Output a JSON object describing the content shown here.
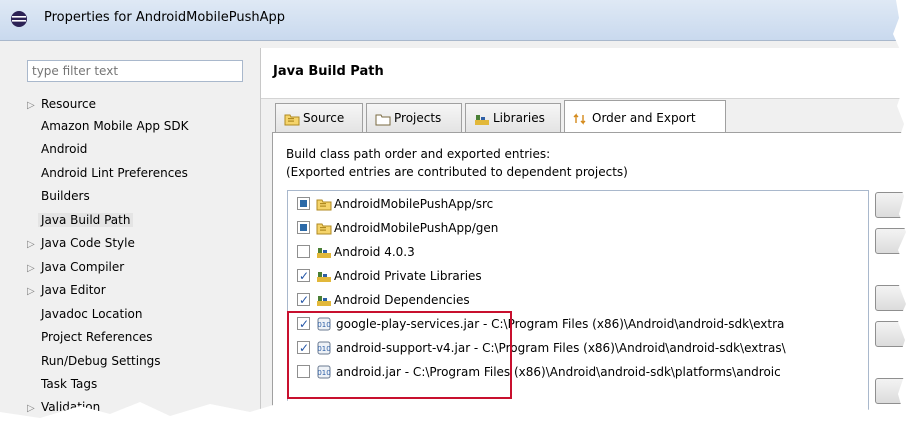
{
  "window": {
    "title": "Properties for AndroidMobilePushApp"
  },
  "filter": {
    "placeholder": "type filter text"
  },
  "tree": {
    "items": [
      {
        "label": "Resource",
        "expandable": true
      },
      {
        "label": "Amazon Mobile App SDK",
        "expandable": false
      },
      {
        "label": "Android",
        "expandable": false
      },
      {
        "label": "Android Lint Preferences",
        "expandable": false
      },
      {
        "label": "Builders",
        "expandable": false
      },
      {
        "label": "Java Build Path",
        "expandable": false,
        "selected": true
      },
      {
        "label": "Java Code Style",
        "expandable": true
      },
      {
        "label": "Java Compiler",
        "expandable": true
      },
      {
        "label": "Java Editor",
        "expandable": true
      },
      {
        "label": "Javadoc Location",
        "expandable": false
      },
      {
        "label": "Project References",
        "expandable": false
      },
      {
        "label": "Run/Debug Settings",
        "expandable": false
      },
      {
        "label": "Task Tags",
        "expandable": false
      },
      {
        "label": "Validation",
        "expandable": true
      }
    ]
  },
  "page": {
    "title": "Java Build Path"
  },
  "tabs": [
    {
      "label": "Source",
      "icon": "source-folder-icon"
    },
    {
      "label": "Projects",
      "icon": "project-folder-icon"
    },
    {
      "label": "Libraries",
      "icon": "library-icon"
    },
    {
      "label": "Order and Export",
      "icon": "order-export-icon",
      "active": true
    }
  ],
  "description": {
    "line1": "Build class path order and exported entries:",
    "line2": "(Exported entries are contributed to dependent projects)"
  },
  "entries": [
    {
      "label": "AndroidMobilePushApp/src",
      "icon": "source-folder-icon",
      "state": "indeterminate"
    },
    {
      "label": "AndroidMobilePushApp/gen",
      "icon": "source-folder-icon",
      "state": "indeterminate"
    },
    {
      "label": "Android 4.0.3",
      "icon": "library-icon",
      "state": "unchecked"
    },
    {
      "label": "Android Private Libraries",
      "icon": "library-icon",
      "state": "checked"
    },
    {
      "label": "Android Dependencies",
      "icon": "library-icon",
      "state": "checked"
    },
    {
      "label": "google-play-services.jar - C:\\Program Files (x86)\\Android\\android-sdk\\extra",
      "icon": "jar-icon",
      "state": "checked"
    },
    {
      "label": "android-support-v4.jar - C:\\Program Files (x86)\\Android\\android-sdk\\extras\\",
      "icon": "jar-icon",
      "state": "checked"
    },
    {
      "label": "android.jar - C:\\Program Files (x86)\\Android\\android-sdk\\platforms\\androic",
      "icon": "jar-icon",
      "state": "unchecked"
    }
  ],
  "colors": {
    "highlight": "#c8102e",
    "accent": "#2c6aa8"
  }
}
